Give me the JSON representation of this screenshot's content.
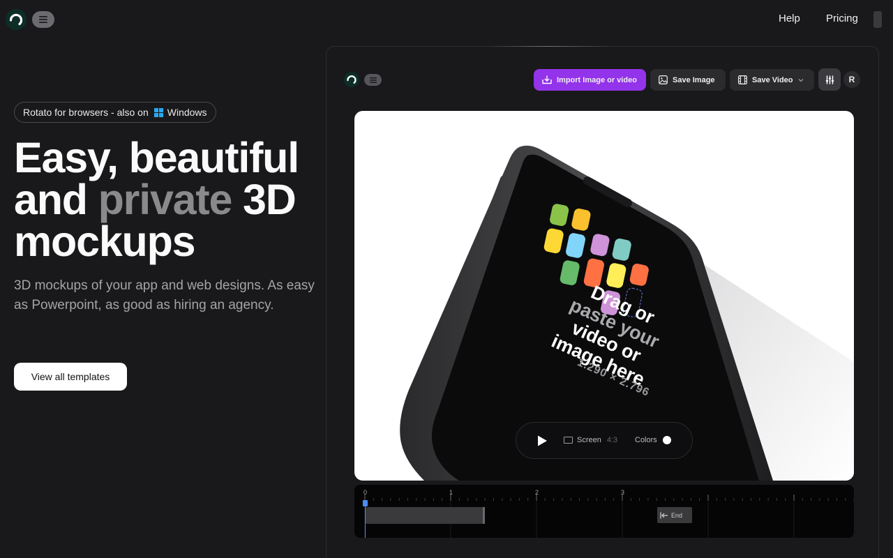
{
  "nav": {
    "help": "Help",
    "pricing": "Pricing"
  },
  "hero": {
    "badge_text": "Rotato for browsers - also on",
    "badge_platform": "Windows",
    "title_line1": "Easy, beautiful",
    "title_and": "and",
    "title_muted": "private",
    "title_3d": "3D",
    "title_line3": "mockups",
    "subtitle": "3D mockups of your app and web designs. As easy as Powerpoint, as good as hiring an agency.",
    "cta": "View all templates"
  },
  "app": {
    "toolbar": {
      "import_label": "Import Image or video",
      "save_image_label": "Save Image",
      "save_video_label": "Save Video",
      "avatar_initial": "R"
    },
    "canvas": {
      "drop_line1": "Drag or",
      "drop_line2": "paste your",
      "drop_line3": "video or",
      "drop_line4": "image here",
      "dimensions": "1.290 × 2.796"
    },
    "playbar": {
      "screen_label": "Screen",
      "screen_ratio": "4:3",
      "colors_label": "Colors"
    },
    "timeline": {
      "ticks": [
        "0",
        "1",
        "2",
        "3"
      ],
      "end_label": "End"
    }
  },
  "colors": {
    "background": "#19191b",
    "accent_purple": "#9333ea",
    "playhead_blue": "#4b8df7",
    "logo_green": "#0c2e27"
  }
}
